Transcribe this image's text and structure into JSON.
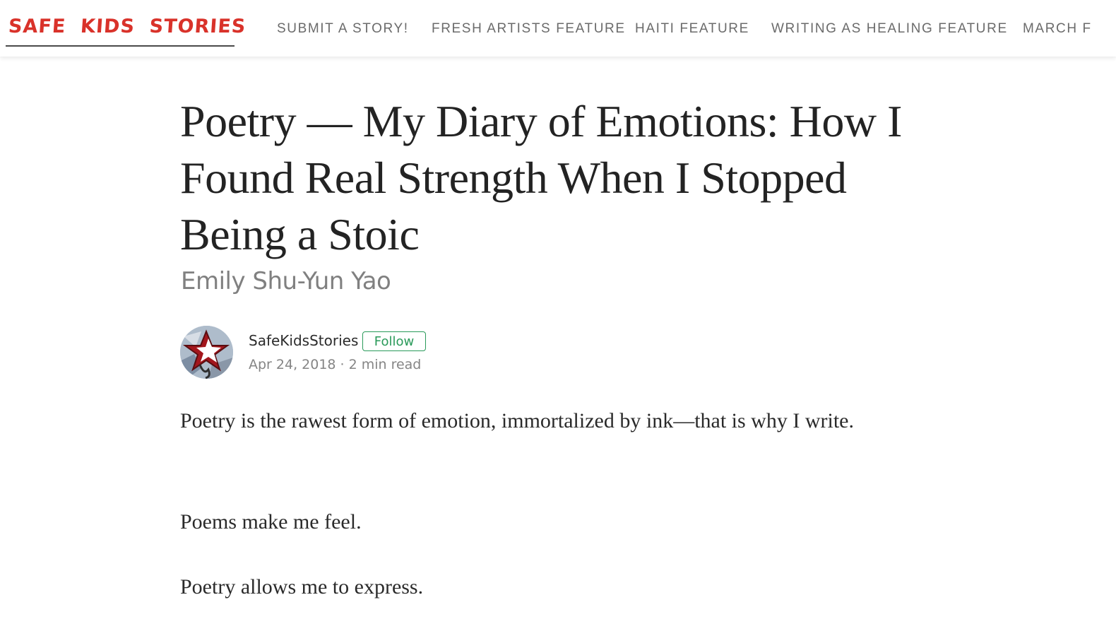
{
  "header": {
    "logo_text": "SAFE  KIDS  STORIES",
    "brand_color": "#d9322a",
    "nav": [
      {
        "label": "SUBMIT A STORY!"
      },
      {
        "label": "FRESH ARTISTS FEATURE"
      },
      {
        "label": "HAITI FEATURE"
      },
      {
        "label": "WRITING AS HEALING FEATURE"
      },
      {
        "label": "MARCH FOCUS"
      }
    ]
  },
  "article": {
    "title": "Poetry — My Diary of Emotions: How I Found Real Strength When I Stopped Being a Stoic",
    "subtitle": "Emily Shu-Yun Yao",
    "author": {
      "name": "SafeKidsStories",
      "follow_label": "Follow",
      "date": "Apr 24, 2018",
      "separator": "·",
      "read_time": "2 min read",
      "avatar_icon": "star-avatar-icon"
    },
    "paragraphs": [
      "Poetry is the rawest form of emotion, immortalized by ink—that is why I write.",
      "Poems make me feel.",
      "Poetry allows me to express."
    ]
  },
  "colors": {
    "follow_green": "#2a9a5a",
    "nav_text": "#6b6b6b"
  }
}
